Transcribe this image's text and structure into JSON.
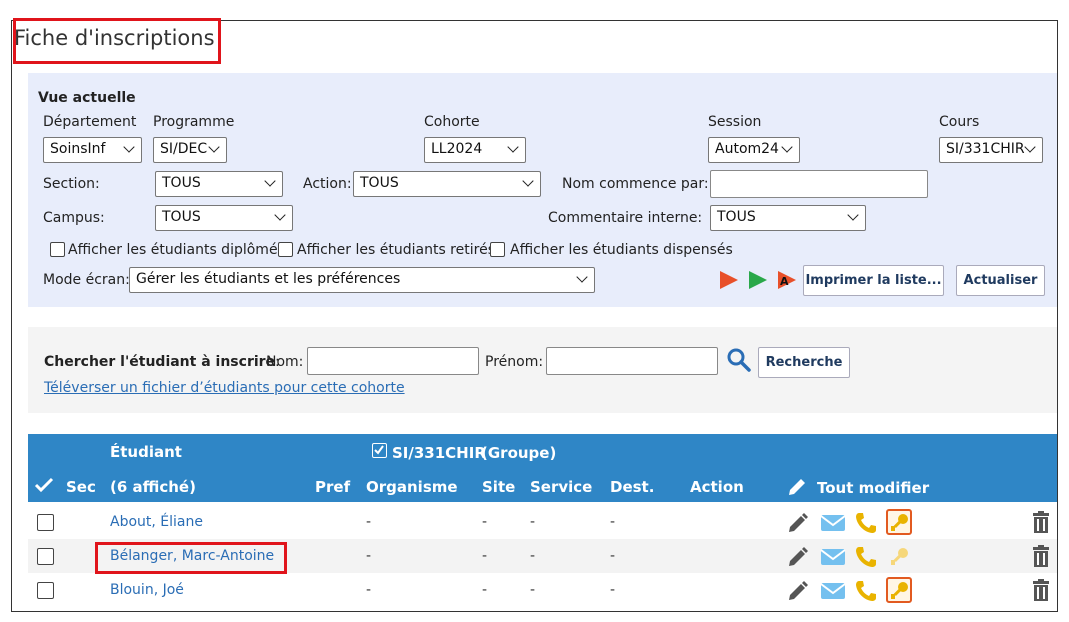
{
  "page": {
    "title": "Fiche d'inscriptions"
  },
  "filters": {
    "heading": "Vue actuelle",
    "departement": {
      "label": "Département",
      "value": "SoinsInf"
    },
    "programme": {
      "label": "Programme",
      "value": "SI/DEC"
    },
    "cohorte": {
      "label": "Cohorte",
      "value": "LL2024"
    },
    "session": {
      "label": "Session",
      "value": "Autom24"
    },
    "cours": {
      "label": "Cours",
      "value": "SI/331CHIR"
    },
    "section": {
      "label": "Section:",
      "value": "TOUS"
    },
    "action": {
      "label": "Action:",
      "value": "TOUS"
    },
    "nom_commence": {
      "label": "Nom commence par:",
      "value": ""
    },
    "campus": {
      "label": "Campus:",
      "value": "TOUS"
    },
    "commentaire": {
      "label": "Commentaire interne:",
      "value": "TOUS"
    },
    "checkboxes": {
      "diplomes": "Afficher les étudiants diplômés",
      "retires": "Afficher les étudiants retirés",
      "dispenses": "Afficher les étudiants dispensés"
    },
    "mode_ecran": {
      "label": "Mode écran:",
      "value": "Gérer les étudiants et les préférences"
    },
    "buttons": {
      "imprimer": "Imprimer la liste...",
      "actualiser": "Actualiser"
    },
    "colors": {
      "play_red": "#e8502a",
      "play_green": "#2aa84a"
    }
  },
  "search": {
    "label": "Chercher l'étudiant à inscrire",
    "colon": ":",
    "nom_label": "Nom:",
    "prenom_label": "Prénom:",
    "nom_value": "",
    "prenom_value": "",
    "button": "Recherche",
    "upload_link": "Téléverser un fichier d’étudiants pour cette cohorte"
  },
  "table": {
    "header": {
      "etudiant": "Étudiant",
      "course": "SI/331CHIR",
      "groupe": "(Groupe)",
      "sec": "Sec",
      "affiche": "(6 affiché)",
      "pref": "Pref",
      "organisme": "Organisme",
      "site": "Site",
      "service": "Service",
      "dest": "Dest.",
      "action": "Action",
      "tout_modifier": "Tout modifier"
    },
    "rows": [
      {
        "name": "About, Éliane",
        "organisme": "-",
        "site": "-",
        "service": "-",
        "dest": "-",
        "key_active": true
      },
      {
        "name": "Bélanger, Marc-Antoine",
        "organisme": "-",
        "site": "-",
        "service": "-",
        "dest": "-",
        "key_active": false
      },
      {
        "name": "Blouin, Joé",
        "organisme": "-",
        "site": "-",
        "service": "-",
        "dest": "-",
        "key_active": true
      }
    ],
    "colors": {
      "header_bg": "#2f86c6",
      "highlight": "#e0141b"
    }
  }
}
